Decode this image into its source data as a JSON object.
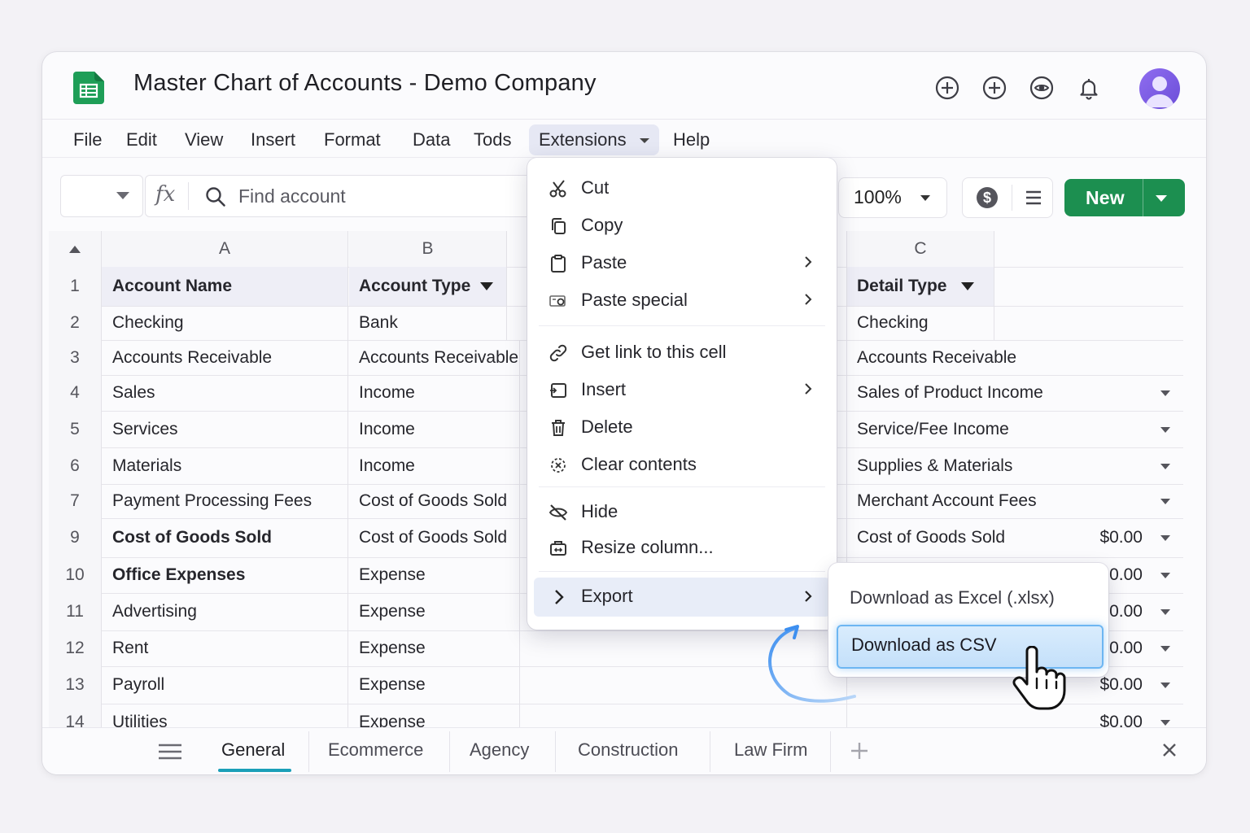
{
  "window": {
    "title": "Master Chart of Accounts - Demo Company"
  },
  "header_icons": [
    "add-circle-icon",
    "add-circle-icon",
    "eye-icon",
    "bell-icon",
    "avatar"
  ],
  "menubar": {
    "items": [
      "File",
      "Edit",
      "View",
      "Insert",
      "Format",
      "Data",
      "Tods",
      "Extensions",
      "Help"
    ],
    "active": "Extensions"
  },
  "toolbar": {
    "fx": "fx",
    "search_placeholder": "Find account",
    "zoom": "100%",
    "new_label": "New"
  },
  "columns": {
    "corner": "",
    "a": "A",
    "b": "B",
    "c": "C"
  },
  "rows": [
    {
      "num": "1",
      "a": "Account Name",
      "b": "Account Type",
      "c": "Detail Type",
      "amount": ""
    },
    {
      "num": "2",
      "a": "Checking",
      "b": "Bank",
      "c": "Checking",
      "amount": ""
    },
    {
      "num": "3",
      "a": "Accounts Receivable",
      "b": "Accounts Receivable",
      "c": "Accounts Receivable",
      "amount": ""
    },
    {
      "num": "4",
      "a": "Sales",
      "b": "Income",
      "c": "Sales of Product Income",
      "amount": ""
    },
    {
      "num": "5",
      "a": "Services",
      "b": "Income",
      "c": "Service/Fee Income",
      "amount": ""
    },
    {
      "num": "6",
      "a": "Materials",
      "b": "Income",
      "c": "Supplies & Materials",
      "amount": ""
    },
    {
      "num": "7",
      "a": "Payment Processing Fees",
      "b": "Cost of Goods Sold",
      "c": "Merchant Account Fees",
      "amount": ""
    },
    {
      "num": "9",
      "a": "Cost of Goods Sold",
      "b": "Cost of Goods Sold",
      "c": "Cost of Goods Sold",
      "amount": "$0.00"
    },
    {
      "num": "10",
      "a": "Office Expenses",
      "b": "Expense",
      "c": "",
      "amount": "$0.00"
    },
    {
      "num": "11",
      "a": "Advertising",
      "b": "Expense",
      "c": "",
      "amount": "$0.00"
    },
    {
      "num": "12",
      "a": "Rent",
      "b": "Expense",
      "c": "",
      "amount": "$0.00"
    },
    {
      "num": "13",
      "a": "Payroll",
      "b": "Expense",
      "c": "",
      "amount": "$0.00"
    },
    {
      "num": "14",
      "a": "Utilities",
      "b": "Expense",
      "c": "",
      "amount": "$0.00"
    }
  ],
  "context_menu": {
    "items": [
      {
        "label": "Cut",
        "icon": "scissors-icon"
      },
      {
        "label": "Copy",
        "icon": "copy-icon"
      },
      {
        "label": "Paste",
        "icon": "clipboard-icon"
      },
      {
        "label": "Paste special",
        "icon": "paste-special-icon"
      },
      {
        "label": "Get link to this cell",
        "icon": "link-icon"
      },
      {
        "label": "Insert",
        "icon": "insert-icon"
      },
      {
        "label": "Delete",
        "icon": "trash-icon"
      },
      {
        "label": "Clear contents",
        "icon": "clear-icon"
      },
      {
        "label": "Hide",
        "icon": "hide-icon"
      },
      {
        "label": "Resize column...",
        "icon": "resize-icon"
      },
      {
        "label": "Export",
        "icon": "chevron-right-icon"
      }
    ]
  },
  "submenu": {
    "items": [
      "Download as Excel (.xlsx)",
      "Download as CSV"
    ],
    "selected": "Download as CSV"
  },
  "sheet_tabs": {
    "items": [
      "General",
      "Ecommerce",
      "Agency",
      "Construction",
      "Law Firm"
    ],
    "active": "General"
  },
  "colors": {
    "accent_green": "#1c8f50",
    "tab_underline": "#1a9fb8",
    "selection_blue": "#6db6f2"
  }
}
